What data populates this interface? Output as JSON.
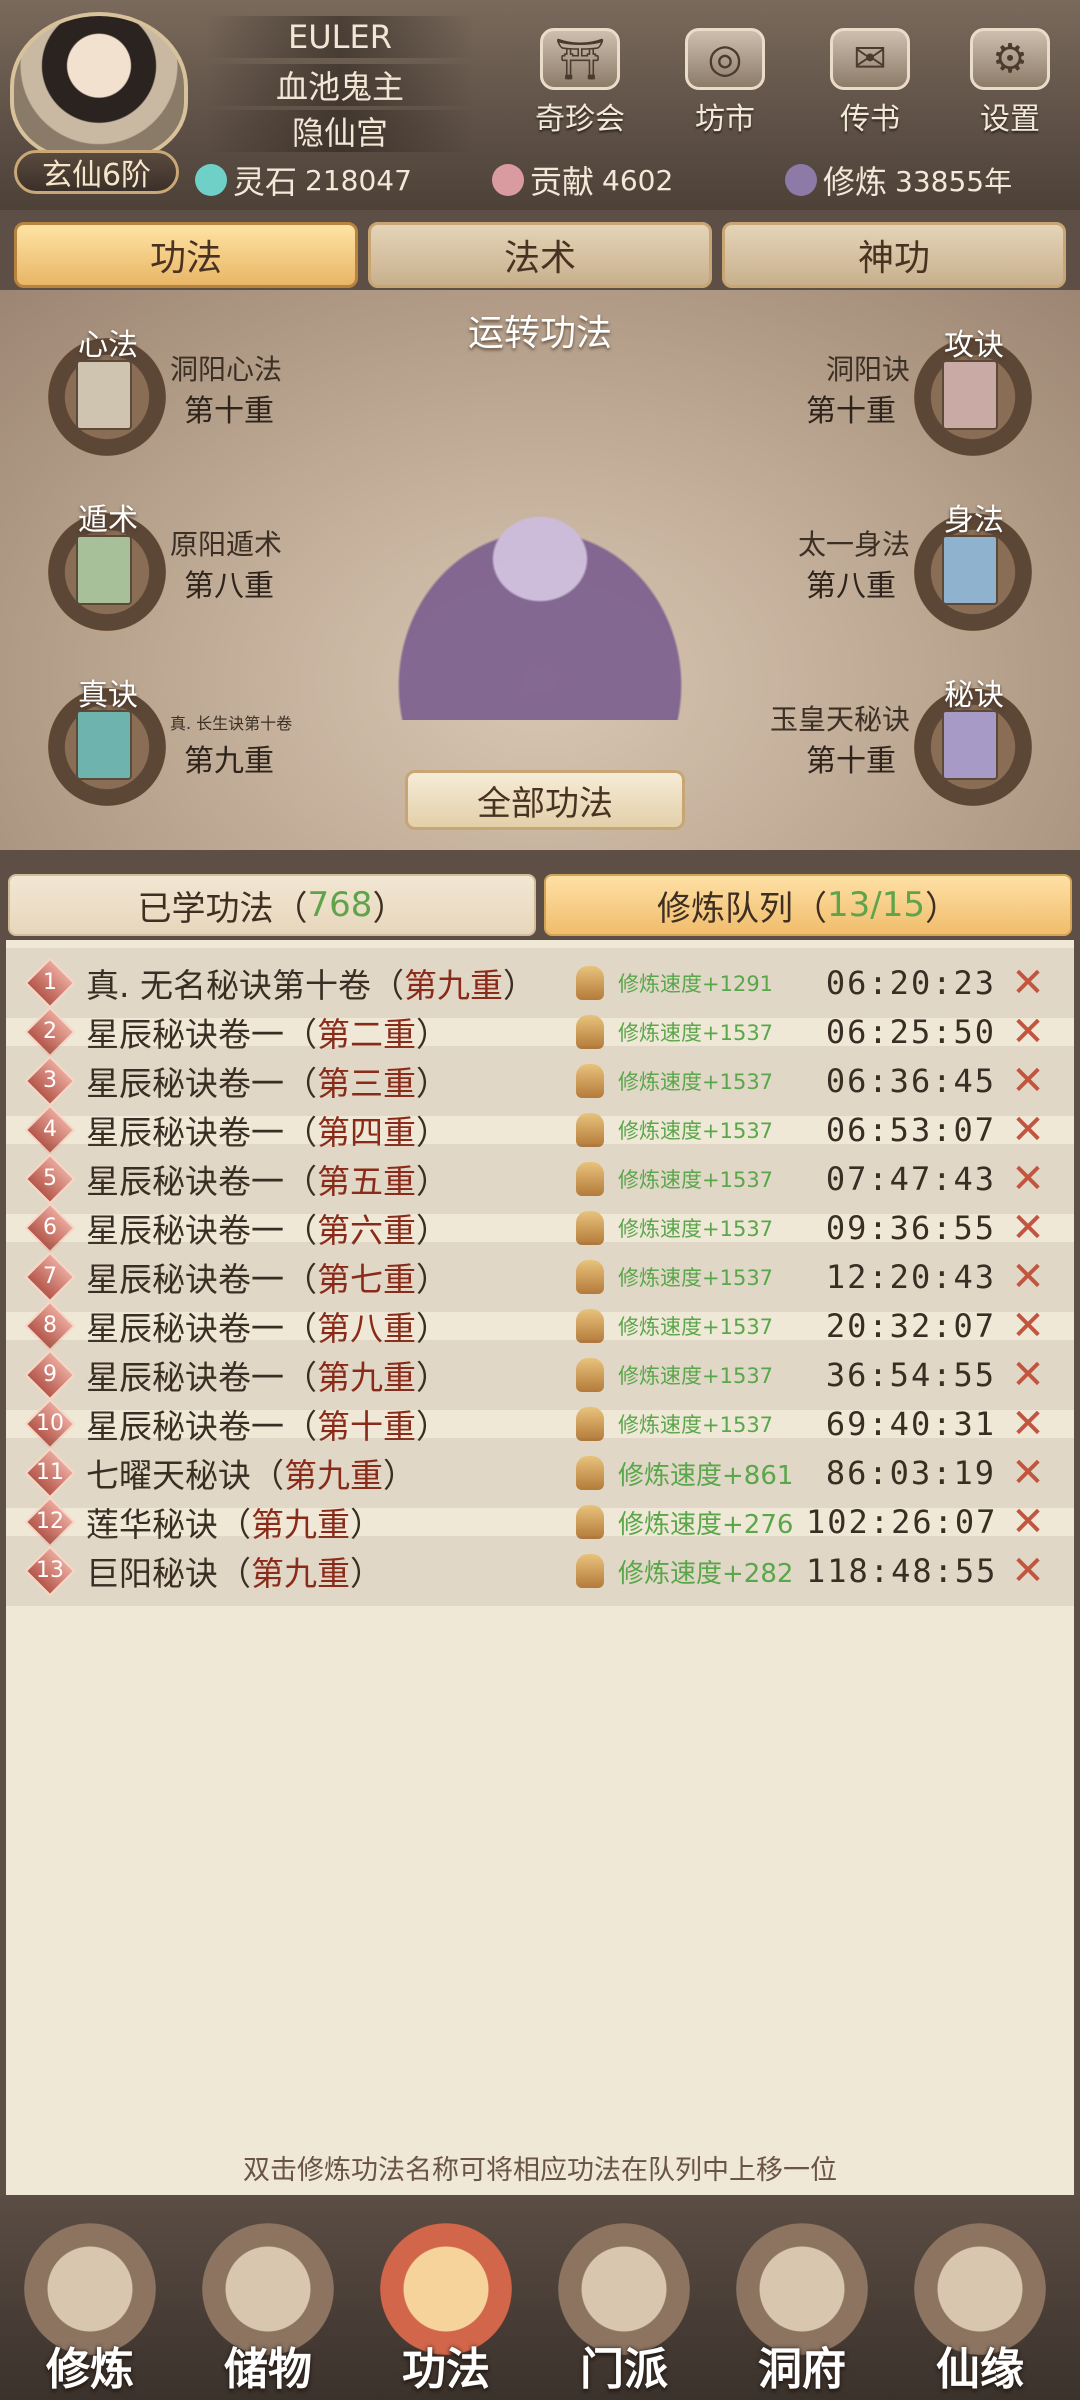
{
  "player": {
    "name": "EULER",
    "title": "血池鬼主",
    "sect": "隐仙宫",
    "realm": "玄仙6阶"
  },
  "top_menu": [
    {
      "label": "奇珍会",
      "icon": "pavilion-icon"
    },
    {
      "label": "坊市",
      "icon": "market-icon"
    },
    {
      "label": "传书",
      "icon": "scroll-icon"
    },
    {
      "label": "设置",
      "icon": "gear-icon"
    }
  ],
  "resources": {
    "spirit_stone": {
      "label": "灵石",
      "value": "218047"
    },
    "contribution": {
      "label": "贡献",
      "value": "4602"
    },
    "cultivation": {
      "label": "修炼",
      "value": "33855年"
    }
  },
  "tabs": [
    "功法",
    "法术",
    "神功"
  ],
  "panel": {
    "title": "运转功法",
    "all_button": "全部功法",
    "slots": [
      {
        "category": "心法",
        "name": "洞阳心法",
        "level": "第十重",
        "side": "left"
      },
      {
        "category": "遁术",
        "name": "原阳遁术",
        "level": "第八重",
        "side": "left"
      },
      {
        "category": "真诀",
        "name": "真. 长生诀第十卷",
        "level": "第九重",
        "side": "left"
      },
      {
        "category": "攻诀",
        "name": "洞阳诀",
        "level": "第十重",
        "side": "right"
      },
      {
        "category": "身法",
        "name": "太一身法",
        "level": "第八重",
        "side": "right"
      },
      {
        "category": "秘诀",
        "name": "玉皇天秘诀",
        "level": "第十重",
        "side": "right"
      }
    ]
  },
  "subtabs": {
    "learned": {
      "label": "已学功法（",
      "count": "768",
      "suffix": "）"
    },
    "queue": {
      "label": "修炼队列（",
      "count": "13/15",
      "suffix": "）"
    }
  },
  "queue": [
    {
      "idx": "1",
      "name": "真. 无名秘诀第十卷（",
      "level": "第九重",
      "close": "）",
      "speed": "修炼速度+1291",
      "time": "06:20:23"
    },
    {
      "idx": "2",
      "name": "星辰秘诀卷一（",
      "level": "第二重",
      "close": "）",
      "speed": "修炼速度+1537",
      "time": "06:25:50"
    },
    {
      "idx": "3",
      "name": "星辰秘诀卷一（",
      "level": "第三重",
      "close": "）",
      "speed": "修炼速度+1537",
      "time": "06:36:45"
    },
    {
      "idx": "4",
      "name": "星辰秘诀卷一（",
      "level": "第四重",
      "close": "）",
      "speed": "修炼速度+1537",
      "time": "06:53:07"
    },
    {
      "idx": "5",
      "name": "星辰秘诀卷一（",
      "level": "第五重",
      "close": "）",
      "speed": "修炼速度+1537",
      "time": "07:47:43"
    },
    {
      "idx": "6",
      "name": "星辰秘诀卷一（",
      "level": "第六重",
      "close": "）",
      "speed": "修炼速度+1537",
      "time": "09:36:55"
    },
    {
      "idx": "7",
      "name": "星辰秘诀卷一（",
      "level": "第七重",
      "close": "）",
      "speed": "修炼速度+1537",
      "time": "12:20:43"
    },
    {
      "idx": "8",
      "name": "星辰秘诀卷一（",
      "level": "第八重",
      "close": "）",
      "speed": "修炼速度+1537",
      "time": "20:32:07"
    },
    {
      "idx": "9",
      "name": "星辰秘诀卷一（",
      "level": "第九重",
      "close": "）",
      "speed": "修炼速度+1537",
      "time": "36:54:55"
    },
    {
      "idx": "10",
      "name": "星辰秘诀卷一（",
      "level": "第十重",
      "close": "）",
      "speed": "修炼速度+1537",
      "time": "69:40:31"
    },
    {
      "idx": "11",
      "name": "七曜天秘诀（",
      "level": "第九重",
      "close": "）",
      "speed": "修炼速度+861",
      "time": "86:03:19"
    },
    {
      "idx": "12",
      "name": "莲华秘诀（",
      "level": "第九重",
      "close": "）",
      "speed": "修炼速度+276",
      "time": "102:26:07"
    },
    {
      "idx": "13",
      "name": "巨阳秘诀（",
      "level": "第九重",
      "close": "）",
      "speed": "修炼速度+282",
      "time": "118:48:55"
    }
  ],
  "hint": "双击修炼功法名称可将相应功法在队列中上移一位",
  "bottom_nav": [
    {
      "label": "修炼",
      "active": false
    },
    {
      "label": "储物",
      "active": false
    },
    {
      "label": "功法",
      "active": true
    },
    {
      "label": "门派",
      "active": false
    },
    {
      "label": "洞府",
      "active": false
    },
    {
      "label": "仙缘",
      "active": false
    }
  ],
  "colors": {
    "speed": "#5aa64a",
    "level": "#8a2b1a",
    "cancel": "#c2553f"
  }
}
